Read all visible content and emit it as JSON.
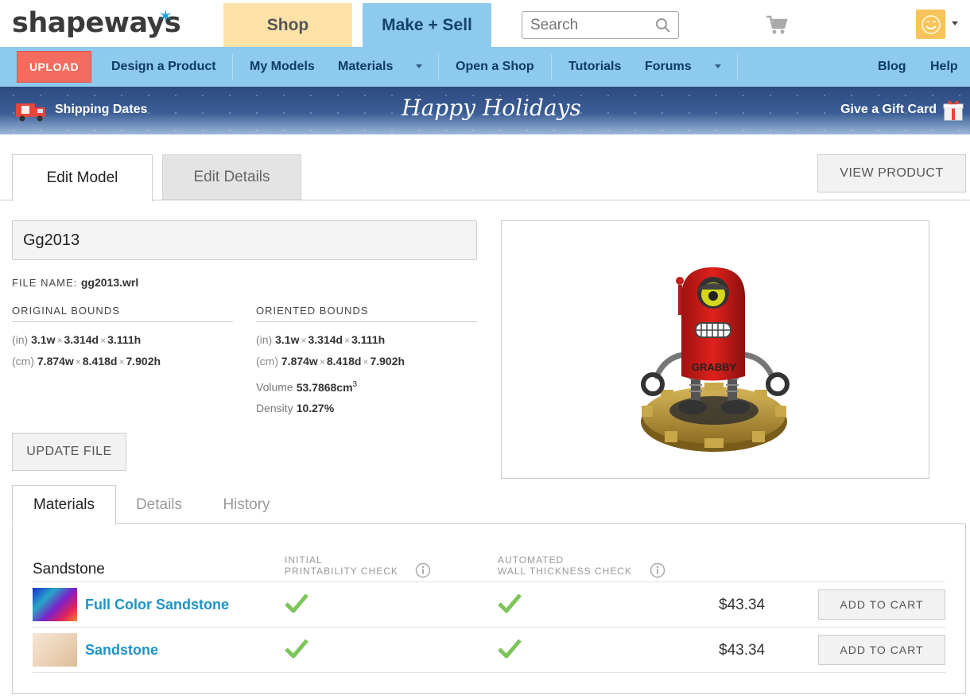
{
  "header": {
    "logo": "shapeways",
    "tab_shop": "Shop",
    "tab_make_sell": "Make + Sell",
    "search_placeholder": "Search"
  },
  "nav": {
    "upload": "UPLOAD",
    "items": [
      "Design a Product",
      "My Models",
      "Materials",
      "Open a Shop",
      "Tutorials",
      "Forums"
    ],
    "right_items": [
      "Blog",
      "Help"
    ]
  },
  "banner": {
    "left": "Shipping Dates",
    "center": "Happy Holidays",
    "right": "Give a Gift Card"
  },
  "edit_tabs": {
    "edit_model": "Edit Model",
    "edit_details": "Edit Details",
    "view_product": "VIEW PRODUCT"
  },
  "model": {
    "name": "Gg2013",
    "file_name_label": "FILE NAME:",
    "file_name": "gg2013.wrl",
    "original_bounds_label": "ORIGINAL BOUNDS",
    "oriented_bounds_label": "ORIENTED BOUNDS",
    "original": {
      "in_unit": "(in)",
      "in_w": "3.1w",
      "in_d": "3.314d",
      "in_h": "3.111h",
      "cm_unit": "(cm)",
      "cm_w": "7.874w",
      "cm_d": "8.418d",
      "cm_h": "7.902h"
    },
    "oriented": {
      "in_unit": "(in)",
      "in_w": "3.1w",
      "in_d": "3.314d",
      "in_h": "3.111h",
      "cm_unit": "(cm)",
      "cm_w": "7.874w",
      "cm_d": "8.418d",
      "cm_h": "7.902h"
    },
    "volume_label": "Volume",
    "volume_value": "53.7868cm",
    "volume_exp": "3",
    "density_label": "Density",
    "density_value": "10.27%",
    "update_file": "UPDATE FILE",
    "preview_text": "GRABBY"
  },
  "materials": {
    "tabs": [
      "Materials",
      "Details",
      "History"
    ],
    "group": "Sandstone",
    "col_initial_1": "INITIAL",
    "col_initial_2": "PRINTABILITY CHECK",
    "col_wall_1": "AUTOMATED",
    "col_wall_2": "WALL THICKNESS CHECK",
    "rows": [
      {
        "name": "Full Color Sandstone",
        "price": "$43.34",
        "button": "ADD TO CART"
      },
      {
        "name": "Sandstone",
        "price": "$43.34",
        "button": "ADD TO CART"
      }
    ]
  },
  "colors": {
    "accent_blue": "#8ec9ee",
    "upload_red": "#f36c5f",
    "link_blue": "#1e93c8",
    "check_green": "#7cc55a"
  }
}
